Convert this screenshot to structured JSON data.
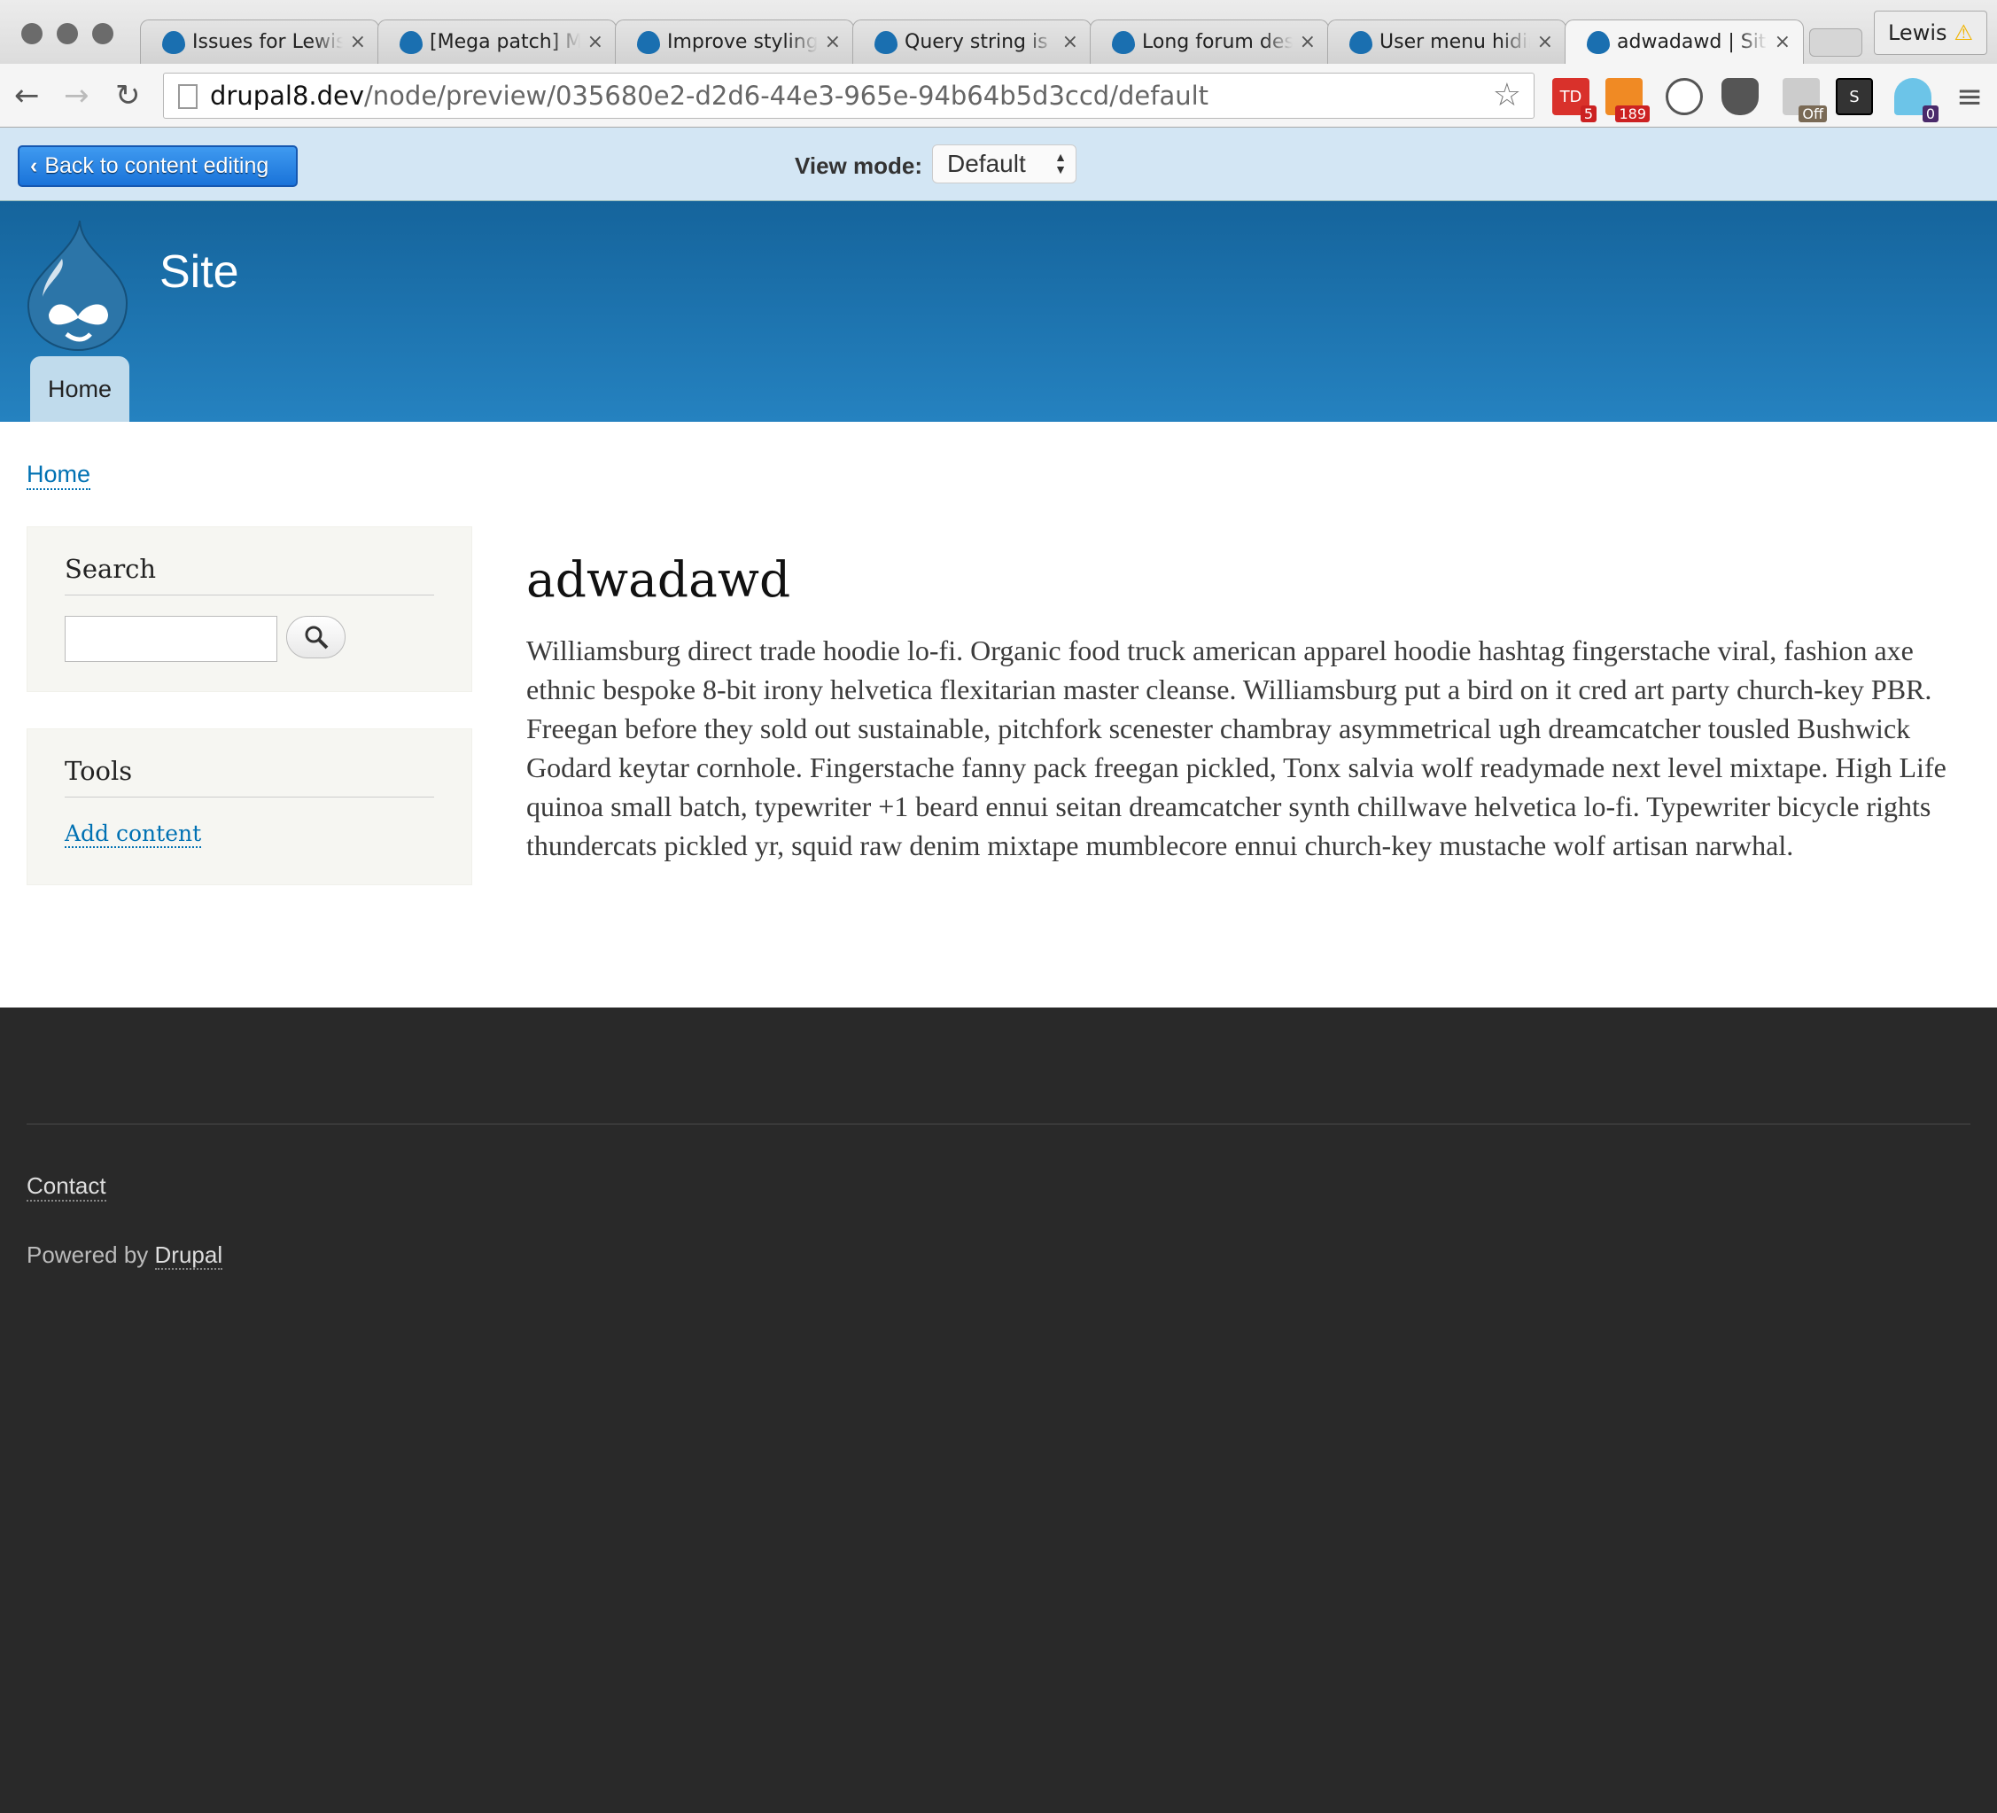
{
  "browser": {
    "tabs": [
      {
        "title": "Issues for Lewisl"
      },
      {
        "title": "[Mega patch] Mc"
      },
      {
        "title": "Improve styling"
      },
      {
        "title": "Query string is a"
      },
      {
        "title": "Long forum des"
      },
      {
        "title": "User menu hidir"
      },
      {
        "title": "adwadawd | Site",
        "active": true
      }
    ],
    "close_glyph": "×",
    "profile_name": "Lewis",
    "url_host": "drupal8.dev",
    "url_path": "/node/preview/035680e2-d2d6-44e3-965e-94b64b5d3ccd/default",
    "extensions": [
      {
        "icon": "tweetdeck-icon",
        "label": "TD",
        "badge": "5",
        "color": "#d9312b"
      },
      {
        "icon": "rss-icon",
        "label": "",
        "badge": "189",
        "color": "#f08a24"
      },
      {
        "icon": "1password-icon",
        "label": "",
        "badge": "",
        "color": "#555555"
      },
      {
        "icon": "pocket-icon",
        "label": "",
        "badge": "",
        "color": "#555555"
      },
      {
        "icon": "toggle-off-icon",
        "label": "",
        "badge": "Off",
        "color": "#7a6a55"
      },
      {
        "icon": "s-extension-icon",
        "label": "S",
        "badge": "",
        "color": "#333333"
      },
      {
        "icon": "ghostery-icon",
        "label": "",
        "badge": "0",
        "color": "#6cc4e8"
      }
    ]
  },
  "preview_bar": {
    "back_label": "Back to content editing",
    "view_mode_label": "View mode:",
    "view_mode_value": "Default"
  },
  "header": {
    "site_name": "Site",
    "nav": [
      {
        "label": "Home"
      }
    ]
  },
  "breadcrumb": [
    "Home"
  ],
  "sidebar": {
    "search_title": "Search",
    "search_value": "",
    "tools_title": "Tools",
    "tools_links": [
      "Add content"
    ]
  },
  "main": {
    "title": "adwadawd",
    "body": "Williamsburg direct trade hoodie lo-fi. Organic food truck american apparel hoodie hashtag fingerstache viral, fashion axe ethnic bespoke 8-bit irony helvetica flexitarian master cleanse. Williamsburg put a bird on it cred art party church-key PBR. Freegan before they sold out sustainable, pitchfork scenester chambray asymmetrical ugh dreamcatcher tousled Bushwick Godard keytar cornhole. Fingerstache fanny pack freegan pickled, Tonx salvia wolf readymade next level mixtape. High Life quinoa small batch, typewriter +1 beard ennui seitan dreamcatcher synth chillwave helvetica lo-fi. Typewriter bicycle rights thundercats pickled yr, squid raw denim mixtape mumblecore ennui church-key mustache wolf artisan narwhal."
  },
  "footer": {
    "contact": "Contact",
    "powered_prefix": "Powered by ",
    "powered_link": "Drupal"
  }
}
